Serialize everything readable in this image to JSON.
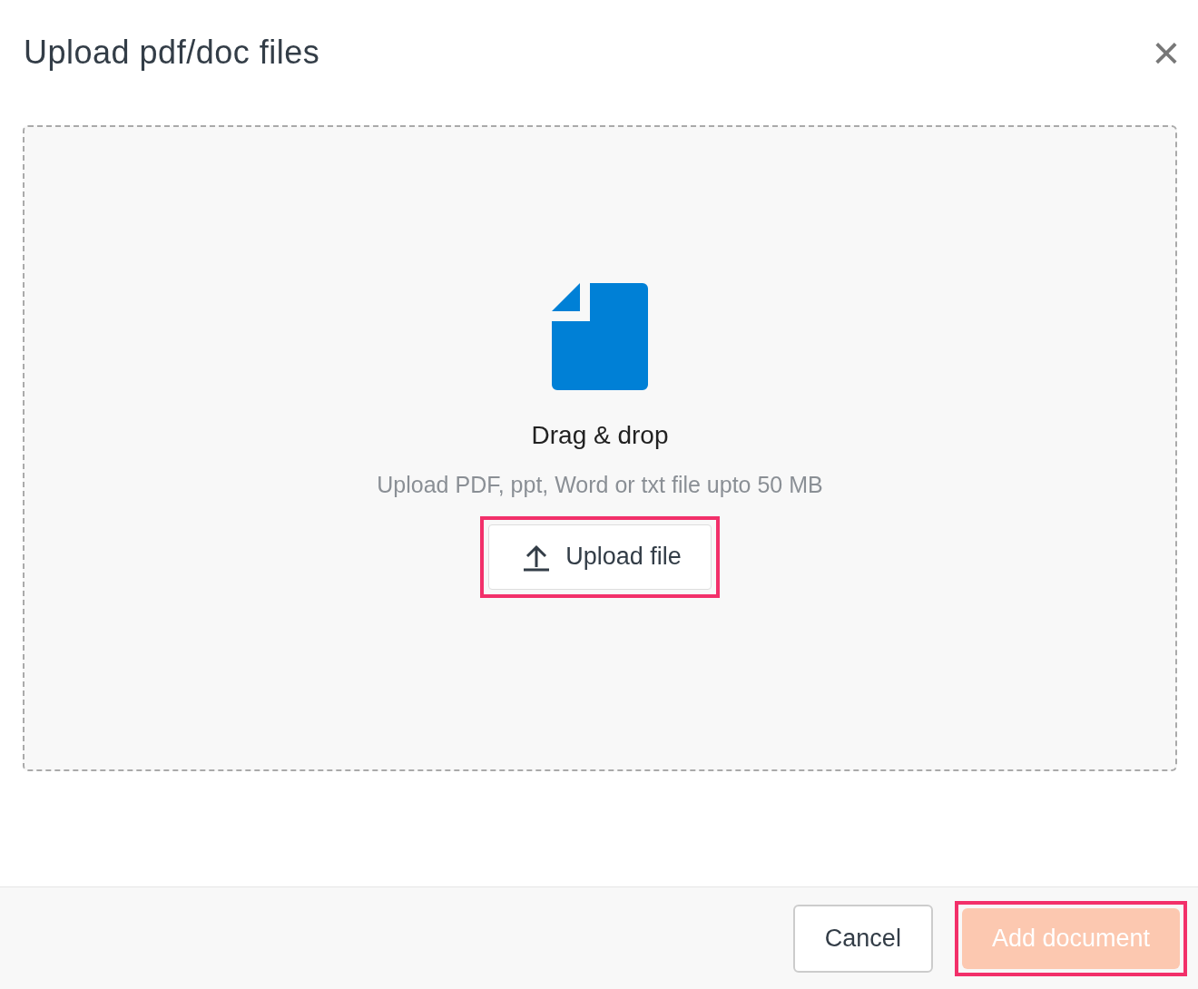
{
  "dialog": {
    "title": "Upload pdf/doc files",
    "close": "×"
  },
  "dropzone": {
    "heading": "Drag & drop",
    "hint": "Upload PDF, ppt, Word or txt file upto 50 MB",
    "upload_button": {
      "label": "Upload file",
      "highlighted": true
    }
  },
  "footer": {
    "buttons": [
      {
        "label": "Cancel",
        "kind": "secondary",
        "disabled": false,
        "highlighted": false
      },
      {
        "label": "Add document",
        "kind": "primary",
        "disabled": true,
        "highlighted": true
      }
    ]
  }
}
